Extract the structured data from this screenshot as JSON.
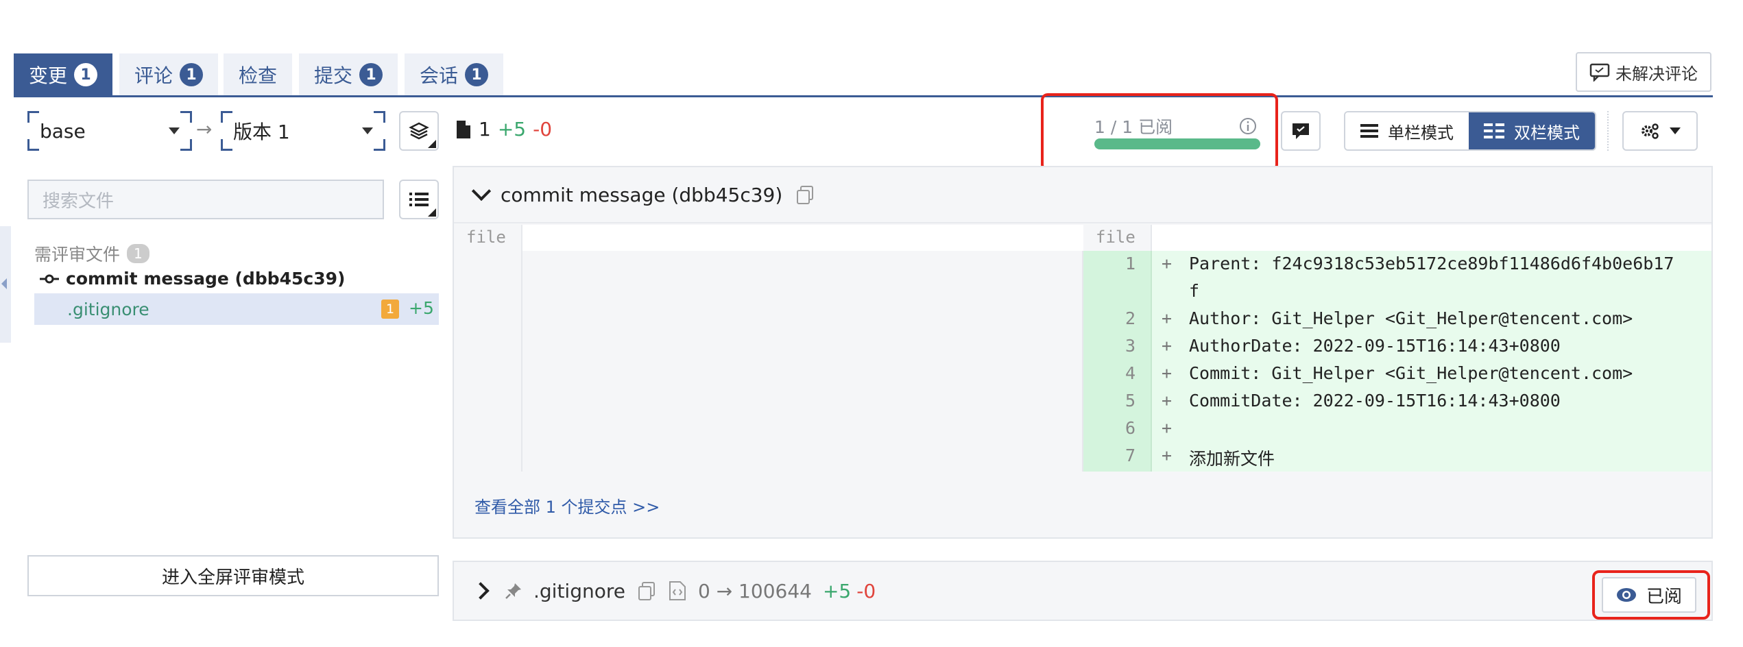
{
  "tabs": [
    {
      "label": "变更",
      "count": "1",
      "active": true
    },
    {
      "label": "评论",
      "count": "1",
      "active": false
    },
    {
      "label": "检查",
      "count": "",
      "active": false
    },
    {
      "label": "提交",
      "count": "1",
      "active": false
    },
    {
      "label": "会话",
      "count": "1",
      "active": false
    }
  ],
  "toolbar": {
    "unresolved_label": "未解决评论",
    "base_select": "base",
    "arrow": "→",
    "version_select": "版本 1",
    "file_count": "1",
    "additions": "+5",
    "deletions": "-0",
    "progress_text": "1 / 1 已阅",
    "progress_fraction": 1.0,
    "single_mode_label": "单栏模式",
    "double_mode_label": "双栏模式"
  },
  "sidebar": {
    "search_placeholder": "搜索文件",
    "section_title": "需评审文件",
    "section_count": "1",
    "commit_label": "commit message (dbb45c39)",
    "file_name": ".gitignore",
    "file_comment_count": "1",
    "file_additions": "+5",
    "fullscreen_label": "进入全屏评审模式"
  },
  "diff": {
    "title": "commit message (dbb45c39)",
    "left_header": "file",
    "right_header": "file",
    "lines": [
      {
        "no": "1",
        "sign": "+",
        "text": "Parent: f24c9318c53eb5172ce89bf11486d6f4b0e6b17"
      },
      {
        "no": "",
        "sign": "",
        "text": "f"
      },
      {
        "no": "2",
        "sign": "+",
        "text": "Author: Git_Helper <Git_Helper@tencent.com>"
      },
      {
        "no": "3",
        "sign": "+",
        "text": "AuthorDate: 2022-09-15T16:14:43+0800"
      },
      {
        "no": "4",
        "sign": "+",
        "text": "Commit: Git_Helper <Git_Helper@tencent.com>"
      },
      {
        "no": "5",
        "sign": "+",
        "text": "CommitDate: 2022-09-15T16:14:43+0800"
      },
      {
        "no": "6",
        "sign": "+",
        "text": ""
      },
      {
        "no": "7",
        "sign": "+",
        "text": "添加新文件"
      }
    ],
    "view_all": "查看全部 1 个提交点 >>"
  },
  "file_bar": {
    "name": ".gitignore",
    "mode_change": "0 → 100644",
    "additions": "+5",
    "deletions": "-0",
    "read_label": "已阅"
  }
}
